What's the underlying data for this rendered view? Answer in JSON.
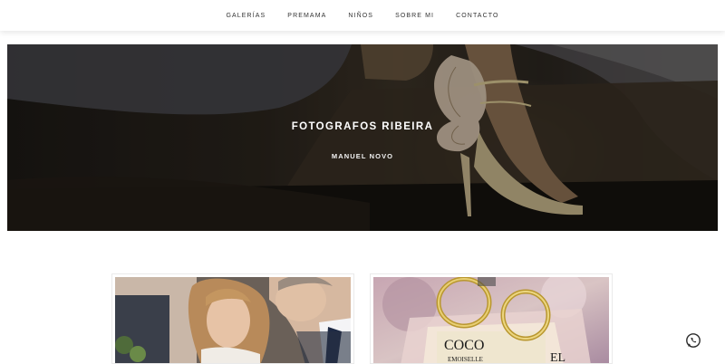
{
  "nav": {
    "items": [
      {
        "label": "GALERÍAS"
      },
      {
        "label": "PREMAMA"
      },
      {
        "label": "NIÑOS"
      },
      {
        "label": "SOBRE MI"
      },
      {
        "label": "CONTACTO"
      }
    ]
  },
  "hero": {
    "title": "FOTOGRAFOS RIBEIRA",
    "subtitle": "MANUEL NOVO"
  },
  "gallery": {
    "cards": [
      {
        "image": "bride-and-father-photo"
      },
      {
        "image": "wedding-rings-on-perfume-photo",
        "text_top": "COCO",
        "text_bottom": "EMOISELLE",
        "text_side": "EL"
      }
    ]
  },
  "floating": {
    "icon": "whatsapp-icon"
  },
  "colors": {
    "nav_text": "#333333",
    "hero_text": "#ffffff",
    "background": "#ffffff"
  }
}
